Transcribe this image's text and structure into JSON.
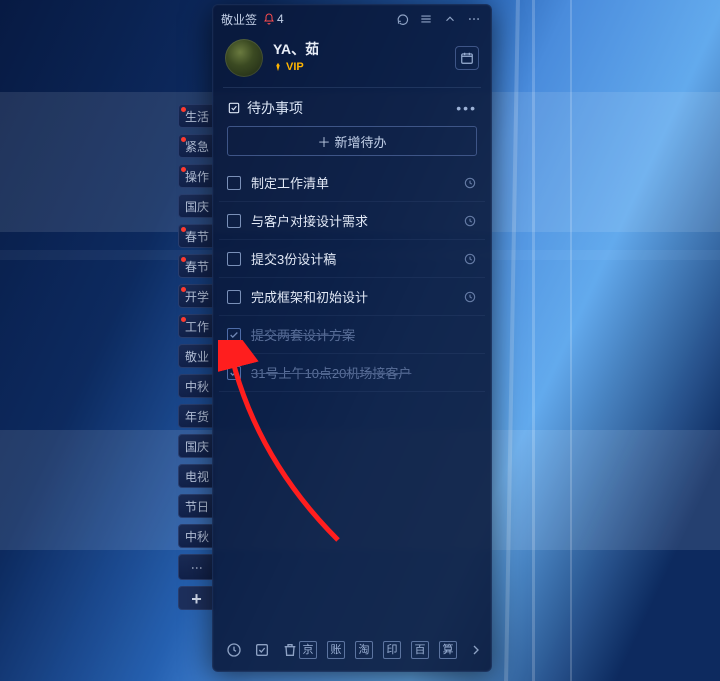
{
  "app": {
    "title": "敬业签",
    "notif_count": "4"
  },
  "user": {
    "name": "YA、茹",
    "vip_label": "VIP"
  },
  "sidebar_tabs": [
    {
      "label": "生活",
      "red": true
    },
    {
      "label": "紧急",
      "red": true
    },
    {
      "label": "操作",
      "red": true
    },
    {
      "label": "国庆",
      "red": false
    },
    {
      "label": "春节",
      "red": true
    },
    {
      "label": "春节",
      "red": true
    },
    {
      "label": "开学",
      "red": true
    },
    {
      "label": "工作",
      "red": true
    },
    {
      "label": "敬业",
      "red": false
    },
    {
      "label": "中秋",
      "red": false
    },
    {
      "label": "年货",
      "red": false
    },
    {
      "label": "国庆",
      "red": false
    },
    {
      "label": "电视",
      "red": false
    },
    {
      "label": "节日",
      "red": false
    },
    {
      "label": "中秋",
      "red": false
    }
  ],
  "section": {
    "title": "待办事项"
  },
  "add_button": {
    "label": "新增待办"
  },
  "todos": [
    {
      "text": "制定工作清单",
      "done": false,
      "has_clock": true
    },
    {
      "text": "与客户对接设计需求",
      "done": false,
      "has_clock": true
    },
    {
      "text": "提交3份设计稿",
      "done": false,
      "has_clock": true
    },
    {
      "text": "完成框架和初始设计",
      "done": false,
      "has_clock": true
    },
    {
      "text": "提交两套设计方案",
      "done": true,
      "has_clock": false
    },
    {
      "text": "31号上午10点20机场接客户",
      "done": true,
      "has_clock": false
    }
  ],
  "bottom_shortcuts": [
    "京",
    "账",
    "淘",
    "印",
    "百",
    "算"
  ]
}
